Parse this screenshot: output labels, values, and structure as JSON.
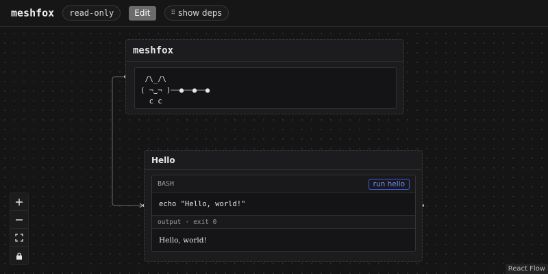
{
  "app": {
    "title": "meshfox",
    "mode_badge": "read-only",
    "edit_label": "Edit",
    "deps_label": "show deps",
    "deps_icon": "graph-nodes-icon"
  },
  "nodes": {
    "meshfox": {
      "title": "meshfox",
      "ascii_art": " /\\_/\\\n( ¬‿¬ )──●──●──●\n  c c"
    },
    "hello": {
      "title": "Hello",
      "language": "BASH",
      "run_label": "run hello",
      "code": "echo \"Hello, world!\"",
      "output_label": "output",
      "exit_status": "exit 0",
      "output": "Hello, world!"
    }
  },
  "controls": {
    "zoom_in": "+",
    "zoom_out": "—",
    "fit_icon": "fit-view-icon",
    "lock_icon": "lock-icon"
  },
  "attribution": "React Flow",
  "colors": {
    "background": "#151515",
    "node": "#1c1c1e",
    "accent": "#3a5ee8",
    "edge": "#6a6a6a"
  }
}
